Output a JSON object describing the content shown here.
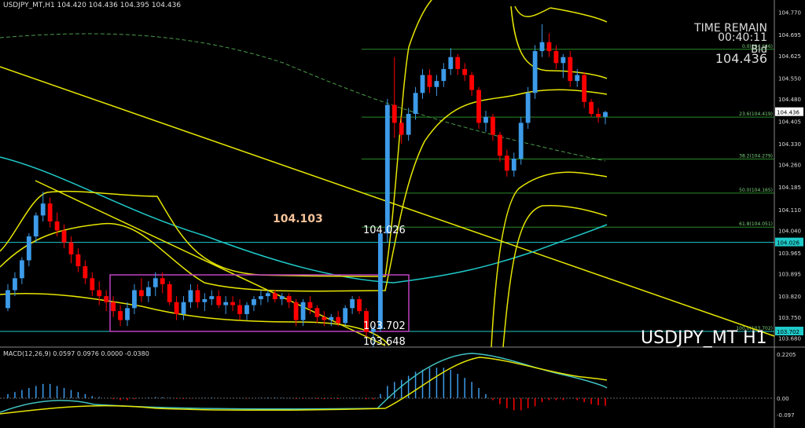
{
  "symbol_header": "USDJPY_MT,H1  104.420 104.436 104.395 104.436",
  "time_remain_label": "TIME REMAIN",
  "time_remain_value": "00:40:11",
  "bid_label": "Bid",
  "bid_value": "104.436",
  "watermark": "USDJPY_MT H1",
  "macd_header": "MACD(12,26,9) 0.0597 0.0976 0.0000 -0.0380",
  "annotations": {
    "high_label": "104.103",
    "mid_label": "104.026",
    "box_low_label": "103.702",
    "low_label": "103.648"
  },
  "price_axis": {
    "labels": [
      "104.770",
      "104.695",
      "104.625",
      "104.550",
      "104.480",
      "104.405",
      "104.330",
      "104.260",
      "104.185",
      "104.110",
      "104.040",
      "103.965",
      "103.895",
      "103.820",
      "103.750",
      "103.680"
    ],
    "current_price": "104.436",
    "level_104026": "104.026",
    "level_103702": "103.702"
  },
  "fib_labels": [
    "0.0(104.646)",
    "23.6(104.419)",
    "38.2(104.279)",
    "50.0(104.165)",
    "61.8(104.051)",
    "100.0(103.702)"
  ],
  "macd_axis": [
    "0.2205",
    "0.00",
    "-0.097"
  ],
  "colors": {
    "bull": "#3d9be9",
    "bear": "#ff0000",
    "bands": "#e6e600",
    "ma_cyan": "#1fc9c9",
    "fib": "#2a8a2a",
    "box": "#c040c0",
    "macd_line": "#40c0c0",
    "signal_line": "#e6e600"
  },
  "chart_data": {
    "type": "candlestick",
    "title": "USDJPY_MT,H1",
    "ylim": [
      103.66,
      104.79
    ],
    "fib_levels": [
      104.646,
      104.419,
      104.279,
      104.165,
      104.051,
      103.702
    ],
    "candles": [
      [
        103.78,
        103.86,
        103.77,
        103.84
      ],
      [
        103.84,
        103.9,
        103.82,
        103.88
      ],
      [
        103.88,
        103.95,
        103.86,
        103.94
      ],
      [
        103.94,
        104.03,
        103.92,
        104.02
      ],
      [
        104.02,
        104.1,
        104.0,
        104.09
      ],
      [
        104.09,
        104.17,
        104.07,
        104.13
      ],
      [
        104.13,
        104.15,
        104.05,
        104.07
      ],
      [
        104.07,
        104.1,
        104.02,
        104.04
      ],
      [
        104.04,
        104.06,
        103.98,
        104.0
      ],
      [
        104.0,
        104.02,
        103.93,
        103.96
      ],
      [
        103.96,
        103.98,
        103.9,
        103.92
      ],
      [
        103.92,
        103.94,
        103.86,
        103.88
      ],
      [
        103.88,
        103.9,
        103.82,
        103.84
      ],
      [
        103.84,
        103.87,
        103.79,
        103.82
      ],
      [
        103.82,
        103.84,
        103.77,
        103.8
      ],
      [
        103.8,
        103.82,
        103.75,
        103.77
      ],
      [
        103.77,
        103.79,
        103.72,
        103.74
      ],
      [
        103.74,
        103.8,
        103.72,
        103.78
      ],
      [
        103.78,
        103.86,
        103.76,
        103.84
      ],
      [
        103.84,
        103.88,
        103.8,
        103.82
      ],
      [
        103.82,
        103.87,
        103.8,
        103.85
      ],
      [
        103.85,
        103.9,
        103.82,
        103.88
      ],
      [
        103.88,
        103.9,
        103.83,
        103.86
      ],
      [
        103.86,
        103.87,
        103.79,
        103.8
      ],
      [
        103.8,
        103.82,
        103.74,
        103.76
      ],
      [
        103.76,
        103.82,
        103.74,
        103.8
      ],
      [
        103.8,
        103.86,
        103.78,
        103.84
      ],
      [
        103.84,
        103.86,
        103.78,
        103.8
      ],
      [
        103.8,
        103.83,
        103.77,
        103.81
      ],
      [
        103.81,
        103.84,
        103.79,
        103.82
      ],
      [
        103.82,
        103.84,
        103.78,
        103.79
      ],
      [
        103.79,
        103.82,
        103.76,
        103.8
      ],
      [
        103.8,
        103.82,
        103.77,
        103.79
      ],
      [
        103.79,
        103.81,
        103.74,
        103.76
      ],
      [
        103.76,
        103.8,
        103.74,
        103.79
      ],
      [
        103.79,
        103.82,
        103.77,
        103.81
      ],
      [
        103.81,
        103.84,
        103.79,
        103.82
      ],
      [
        103.82,
        103.84,
        103.8,
        103.83
      ],
      [
        103.83,
        103.84,
        103.8,
        103.81
      ],
      [
        103.81,
        103.83,
        103.79,
        103.82
      ],
      [
        103.82,
        103.83,
        103.78,
        103.8
      ],
      [
        103.8,
        103.81,
        103.72,
        103.74
      ],
      [
        103.74,
        103.81,
        103.72,
        103.8
      ],
      [
        103.8,
        103.82,
        103.76,
        103.78
      ],
      [
        103.78,
        103.79,
        103.73,
        103.75
      ],
      [
        103.75,
        103.77,
        103.72,
        103.74
      ],
      [
        103.74,
        103.76,
        103.72,
        103.75
      ],
      [
        103.75,
        103.77,
        103.72,
        103.73
      ],
      [
        103.73,
        103.79,
        103.72,
        103.78
      ],
      [
        103.78,
        103.82,
        103.76,
        103.81
      ],
      [
        103.81,
        103.82,
        103.76,
        103.77
      ],
      [
        103.77,
        103.78,
        103.68,
        103.7
      ],
      [
        103.7,
        103.72,
        103.65,
        103.71
      ],
      [
        103.71,
        104.05,
        103.7,
        104.03
      ],
      [
        104.03,
        104.48,
        104.0,
        104.46
      ],
      [
        104.46,
        104.62,
        104.35,
        104.4
      ],
      [
        104.4,
        104.42,
        104.33,
        104.36
      ],
      [
        104.36,
        104.45,
        104.34,
        104.43
      ],
      [
        104.43,
        104.52,
        104.41,
        104.5
      ],
      [
        104.5,
        104.58,
        104.48,
        104.56
      ],
      [
        104.56,
        104.58,
        104.5,
        104.52
      ],
      [
        104.52,
        104.56,
        104.49,
        104.54
      ],
      [
        104.54,
        104.6,
        104.52,
        104.58
      ],
      [
        104.58,
        104.65,
        104.56,
        104.62
      ],
      [
        104.62,
        104.63,
        104.56,
        104.58
      ],
      [
        104.58,
        104.6,
        104.54,
        104.56
      ],
      [
        104.56,
        104.57,
        104.49,
        104.51
      ],
      [
        104.51,
        104.52,
        104.38,
        104.4
      ],
      [
        104.4,
        104.44,
        104.37,
        104.42
      ],
      [
        104.42,
        104.43,
        104.34,
        104.36
      ],
      [
        104.36,
        104.37,
        104.27,
        104.29
      ],
      [
        104.29,
        104.31,
        104.22,
        104.24
      ],
      [
        104.24,
        104.3,
        104.22,
        104.28
      ],
      [
        104.28,
        104.42,
        104.26,
        104.4
      ],
      [
        104.4,
        104.52,
        104.38,
        104.5
      ],
      [
        104.5,
        104.66,
        104.48,
        104.64
      ],
      [
        104.64,
        104.73,
        104.62,
        104.67
      ],
      [
        104.67,
        104.7,
        104.62,
        104.64
      ],
      [
        104.64,
        104.66,
        104.58,
        104.6
      ],
      [
        104.6,
        104.63,
        104.55,
        104.62
      ],
      [
        104.62,
        104.64,
        104.52,
        104.54
      ],
      [
        104.54,
        104.58,
        104.52,
        104.56
      ],
      [
        104.56,
        104.57,
        104.45,
        104.47
      ],
      [
        104.47,
        104.48,
        104.42,
        104.43
      ],
      [
        104.43,
        104.45,
        104.4,
        104.42
      ],
      [
        104.42,
        104.44,
        104.395,
        104.436
      ]
    ],
    "macd_hist": [
      0.02,
      0.03,
      0.04,
      0.05,
      0.06,
      0.07,
      0.07,
      0.06,
      0.05,
      0.04,
      0.03,
      0.02,
      0.01,
      0.005,
      0,
      -0.005,
      -0.01,
      -0.01,
      -0.005,
      0,
      0.003,
      0.005,
      0.004,
      0.002,
      -0.003,
      -0.004,
      -0.002,
      0,
      0.002,
      0.003,
      0.001,
      0,
      0.001,
      0,
      -0.002,
      0,
      0.002,
      0.003,
      0.003,
      0.002,
      0.001,
      -0.004,
      -0.003,
      -0.002,
      -0.004,
      -0.005,
      -0.004,
      -0.004,
      0,
      0.002,
      0.001,
      -0.005,
      -0.006,
      0.02,
      0.06,
      0.08,
      0.09,
      0.11,
      0.13,
      0.14,
      0.15,
      0.15,
      0.15,
      0.14,
      0.12,
      0.1,
      0.08,
      0.05,
      0.02,
      -0.01,
      -0.03,
      -0.05,
      -0.06,
      -0.06,
      -0.05,
      -0.04,
      -0.02,
      -0.01,
      -0.01,
      -0.01,
      0,
      -0.01,
      -0.02,
      -0.03,
      -0.035,
      -0.038
    ],
    "macd_range": [
      -0.097,
      0.2205
    ]
  }
}
